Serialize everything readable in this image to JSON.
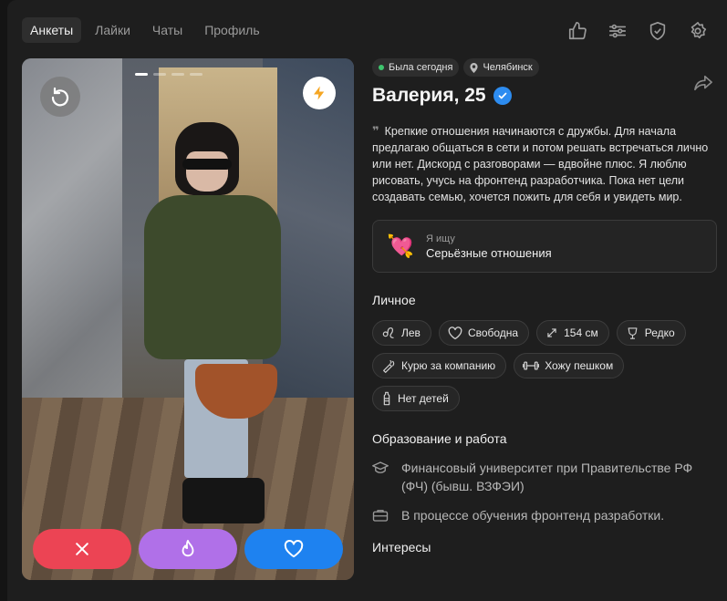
{
  "nav": {
    "tabs": [
      {
        "label": "Анкеты",
        "active": true
      },
      {
        "label": "Лайки",
        "active": false
      },
      {
        "label": "Чаты",
        "active": false
      },
      {
        "label": "Профиль",
        "active": false
      }
    ],
    "icons": [
      "thumbs-up-icon",
      "sliders-icon",
      "shield-check-icon",
      "gear-icon"
    ]
  },
  "photo": {
    "count": 4,
    "current": 1,
    "undo_icon": "undo-icon",
    "boost_icon": "lightning-icon"
  },
  "actions": {
    "dislike_icon": "close-icon",
    "superlike_icon": "flame-icon",
    "like_icon": "heart-icon"
  },
  "profile": {
    "status": "Была сегодня",
    "city": "Челябинск",
    "name_age": "Валерия, 25",
    "verified": true,
    "about": "Крепкие отношения начинаются с дружбы. Для начала предлагаю общаться в сети и потом решать встречаться лично или нет. Дискорд с разговорами — вдвойне плюс. Я люблю рисовать, учусь на фронтенд разработчика. Пока нет цели создавать семью, хочется пожить для себя и увидеть мир.",
    "seeking": {
      "label": "Я ищу",
      "value": "Серьёзные отношения",
      "emoji": "💘"
    }
  },
  "personal": {
    "title": "Личное",
    "chips": [
      {
        "label": "Лев",
        "icon": "leo-icon"
      },
      {
        "label": "Свободна",
        "icon": "heart-outline-icon"
      },
      {
        "label": "154 см",
        "icon": "height-icon"
      },
      {
        "label": "Редко",
        "icon": "glass-icon"
      },
      {
        "label": "Курю за компанию",
        "icon": "smoking-icon"
      },
      {
        "label": "Хожу пешком",
        "icon": "dumbbell-icon"
      },
      {
        "label": "Нет детей",
        "icon": "bottle-icon"
      }
    ]
  },
  "education": {
    "title": "Образование и работа",
    "school": "Финансовый университет при Правительстве РФ (ФЧ) (бывш. ВЗФЭИ)",
    "work": "В процессе обучения фронтенд разработки."
  },
  "interests": {
    "title": "Интересы"
  },
  "colors": {
    "dislike": "#ec4454",
    "superlike": "#b070e8",
    "like": "#1e82f0",
    "verified": "#2d8cf0",
    "online": "#3ec46d"
  }
}
